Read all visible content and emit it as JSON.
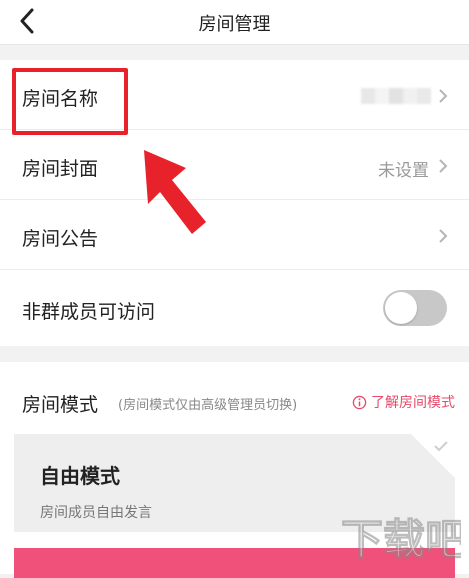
{
  "nav": {
    "title": "房间管理",
    "back_icon": "back-chevron-icon"
  },
  "settings": {
    "room_name": {
      "label": "房间名称",
      "value_blurred": true
    },
    "room_cover": {
      "label": "房间封面",
      "value": "未设置"
    },
    "room_notice": {
      "label": "房间公告"
    },
    "non_member_access": {
      "label": "非群成员可访问",
      "enabled": false
    }
  },
  "room_mode": {
    "title": "房间模式",
    "subtitle": "(房间模式仅由高级管理员切换)",
    "learn_more": "了解房间模式",
    "options": [
      {
        "title": "自由模式",
        "description": "房间成员自由发言",
        "selected": true
      }
    ]
  },
  "colors": {
    "accent": "#e64a6a",
    "highlight": "#e8222b",
    "selected_card": "#f0517a"
  }
}
